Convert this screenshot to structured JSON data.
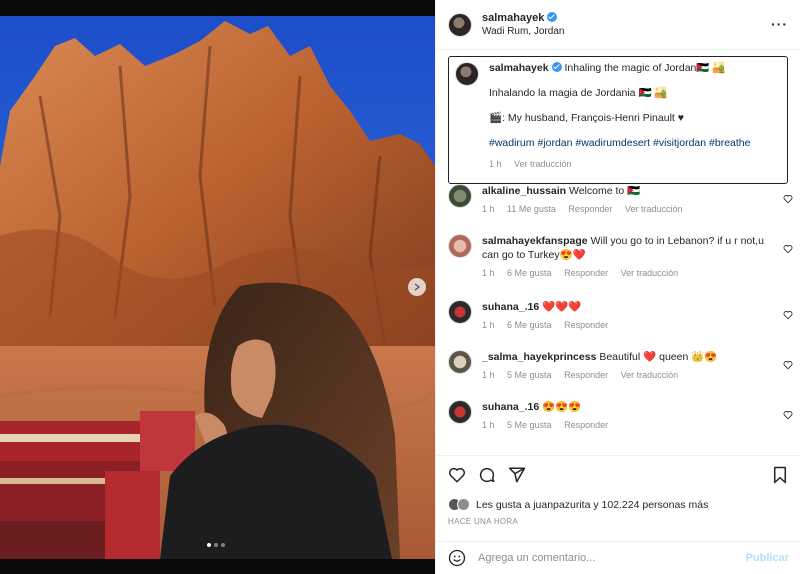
{
  "post": {
    "username": "salmahayek",
    "location": "Wadi Rum, Jordan",
    "more_icon": "more-horizontal-icon",
    "caption": {
      "line1": "Inhaling the magic of Jordan🇯🇴 🏜️",
      "line2": "Inhalando la magia de Jordania 🇯🇴 🏜️",
      "line3": "🎬: My husband, François-Henri Pinault ♥",
      "hashtags": "#wadirum #jordan #wadirumdesert #visitjordan #breathe",
      "time": "1 h",
      "translate": "Ver traducción"
    }
  },
  "comments": [
    {
      "user": "alkaline_hussain",
      "text": "Welcome to 🇯🇴",
      "time": "1 h",
      "likes": "11 Me gusta",
      "reply": "Responder",
      "translate": "Ver traducción"
    },
    {
      "user": "salmahayekfanspage",
      "text": "Will you go to in Lebanon? if u r not,u can go to Turkey😍❤️",
      "time": "1 h",
      "likes": "6 Me gusta",
      "reply": "Responder",
      "translate": "Ver traducción"
    },
    {
      "user": "suhana_.16",
      "text": "❤️❤️❤️",
      "time": "1 h",
      "likes": "6 Me gusta",
      "reply": "Responder",
      "translate": ""
    },
    {
      "user": "_salma_hayekprincess",
      "text": "Beautiful ❤️ queen 👑😍",
      "time": "1 h",
      "likes": "5 Me gusta",
      "reply": "Responder",
      "translate": "Ver traducción"
    },
    {
      "user": "suhana_.16",
      "text": "😍😍😍",
      "time": "1 h",
      "likes": "5 Me gusta",
      "reply": "Responder",
      "translate": ""
    }
  ],
  "actions": {
    "like_icon": "heart-icon",
    "comment_icon": "comment-icon",
    "share_icon": "send-icon",
    "save_icon": "bookmark-icon"
  },
  "likes_text": "Les gusta a juanpazurita y 102.224 personas más",
  "posted": "HACE UNA HORA",
  "comment_input": {
    "placeholder": "Agrega un comentario...",
    "value": ""
  },
  "publish_label": "Publicar",
  "carousel": {
    "current": 1,
    "total": 3
  },
  "colors": {
    "accent": "#3897f0",
    "publish": "#b2dffc",
    "hashtag": "#00376b",
    "heart": "#ed4956"
  }
}
